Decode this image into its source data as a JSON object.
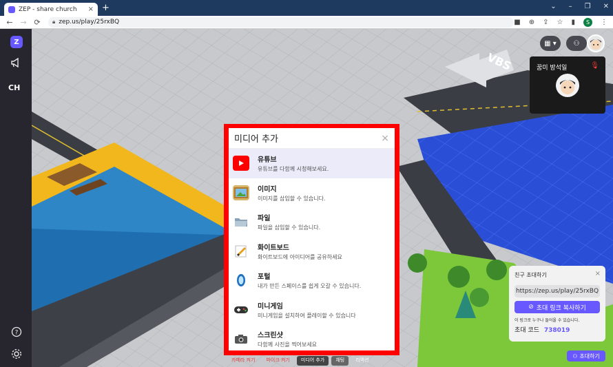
{
  "browser": {
    "tab_title": "ZEP - share church",
    "tab_close": "×",
    "new_tab": "+",
    "url": "zep.us/play/25rxBQ",
    "window_controls": [
      "⌄",
      "–",
      "❐",
      "✕"
    ],
    "profile_initial": "S"
  },
  "sidebar": {
    "logo": "Z",
    "channel": "CH"
  },
  "scene": {
    "sign_text": "VBS"
  },
  "video_panel": {
    "name": "꿈미 방석일"
  },
  "modal": {
    "title": "미디어 추가",
    "close": "×",
    "items": [
      {
        "title": "유튜브",
        "desc": "유튜브를 다함께 시청해보세요.",
        "icon": "youtube-icon"
      },
      {
        "title": "이미지",
        "desc": "이미지를 삽입할 수 있습니다.",
        "icon": "image-icon"
      },
      {
        "title": "파일",
        "desc": "파일을 삽입할 수 있습니다.",
        "icon": "folder-icon"
      },
      {
        "title": "화이트보드",
        "desc": "화이트보드에 아이디어를 공유하세요",
        "icon": "whiteboard-icon"
      },
      {
        "title": "포털",
        "desc": "내가 만든 스페이스를 쉽게 오갈 수 있습니다.",
        "icon": "portal-icon"
      },
      {
        "title": "미니게임",
        "desc": "미니게임을 설치하여 플레이할 수 있습니다",
        "icon": "gamepad-icon"
      },
      {
        "title": "스크린샷",
        "desc": "다함께 사진을 찍어보세요",
        "icon": "camera-icon"
      }
    ]
  },
  "toolbar": {
    "camera": "카메라 켜기",
    "mic": "마이크 켜기",
    "media": "미디어 추가",
    "chat": "채팅",
    "reaction": "리액션"
  },
  "invite": {
    "title": "친구 초대하기",
    "close": "×",
    "link": "https://zep.us/play/25rxBQ",
    "copy_label": "초대 링크 복사하기",
    "note": "이 링크로 누구나 들어올 수 있습니다.",
    "code_label": "초대 코드",
    "code": "738019",
    "invite_button": "초대하기"
  },
  "colors": {
    "accent": "#6758ff",
    "highlight_border": "#ff0000",
    "sidebar_bg": "#27262e"
  }
}
